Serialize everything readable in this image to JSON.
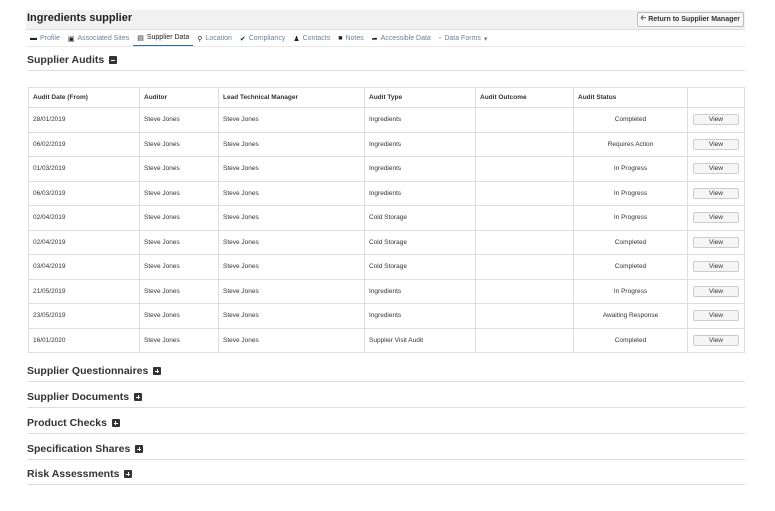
{
  "header": {
    "title": "Ingredients supplier",
    "return_label": "Return to Supplier Manager",
    "return_icon": "arrow-left-icon"
  },
  "nav": {
    "tabs": [
      {
        "label": "Profile",
        "icon": "id-card-icon"
      },
      {
        "label": "Associated Sites",
        "icon": "building-icon"
      },
      {
        "label": "Supplier Data",
        "icon": "list-alt-icon"
      },
      {
        "label": "Location",
        "icon": "map-marker-icon"
      },
      {
        "label": "Compliancy",
        "icon": "check-icon"
      },
      {
        "label": "Contacts",
        "icon": "users-icon"
      },
      {
        "label": "Notes",
        "icon": "note-icon"
      },
      {
        "label": "Accessible Data",
        "icon": "share-icon"
      },
      {
        "label": "Data Forms",
        "icon": "form-icon"
      }
    ],
    "active": "Supplier Data"
  },
  "audits": {
    "title": "Supplier Audits",
    "columns": [
      "Audit Date (From)",
      "Auditor",
      "Lead Technical Manager",
      "Audit Type",
      "Audit Outcome",
      "Audit Status",
      ""
    ],
    "view_label": "View",
    "rows": [
      {
        "date": "28/01/2019",
        "auditor": "Steve Jones",
        "manager": "Steve Jones",
        "type": "Ingredients",
        "outcome": "",
        "status": "Completed"
      },
      {
        "date": "06/02/2019",
        "auditor": "Steve Jones",
        "manager": "Steve Jones",
        "type": "Ingredients",
        "outcome": "",
        "status": "Requires Action"
      },
      {
        "date": "01/03/2019",
        "auditor": "Steve Jones",
        "manager": "Steve Jones",
        "type": "Ingredients",
        "outcome": "",
        "status": "In Progress"
      },
      {
        "date": "06/03/2019",
        "auditor": "Steve Jones",
        "manager": "Steve Jones",
        "type": "Ingredients",
        "outcome": "",
        "status": "In Progress"
      },
      {
        "date": "02/04/2019",
        "auditor": "Steve Jones",
        "manager": "Steve Jones",
        "type": "Cold Storage",
        "outcome": "",
        "status": "In Progress"
      },
      {
        "date": "02/04/2019",
        "auditor": "Steve Jones",
        "manager": "Steve Jones",
        "type": "Cold Storage",
        "outcome": "",
        "status": "Completed"
      },
      {
        "date": "03/04/2019",
        "auditor": "Steve Jones",
        "manager": "Steve Jones",
        "type": "Cold Storage",
        "outcome": "",
        "status": "Completed"
      },
      {
        "date": "21/05/2019",
        "auditor": "Steve Jones",
        "manager": "Steve Jones",
        "type": "Ingredients",
        "outcome": "",
        "status": "In Progress"
      },
      {
        "date": "23/05/2019",
        "auditor": "Steve Jones",
        "manager": "Steve Jones",
        "type": "Ingredients",
        "outcome": "",
        "status": "Awaiting Response"
      },
      {
        "date": "16/01/2020",
        "auditor": "Steve Jones",
        "manager": "Steve Jones",
        "type": "Supplier Visit Audit",
        "outcome": "",
        "status": "Completed"
      }
    ]
  },
  "sections": [
    {
      "title": "Supplier Questionnaires"
    },
    {
      "title": "Supplier Documents"
    },
    {
      "title": "Product Checks"
    },
    {
      "title": "Specification Shares"
    },
    {
      "title": "Risk Assessments"
    }
  ]
}
